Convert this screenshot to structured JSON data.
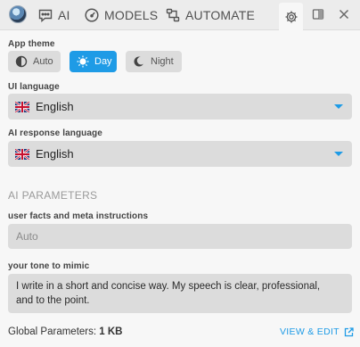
{
  "nav": {
    "ai_label": "AI",
    "models_label": "MODELS",
    "automate_label": "AUTOMATE"
  },
  "app_theme": {
    "label": "App theme",
    "options": [
      {
        "label": "Auto",
        "selected": false
      },
      {
        "label": "Day",
        "selected": true
      },
      {
        "label": "Night",
        "selected": false
      }
    ]
  },
  "ui_language": {
    "label": "UI language",
    "value": "English"
  },
  "ai_response_language": {
    "label": "AI response language",
    "value": "English"
  },
  "ai_parameters": {
    "title": "AI PARAMETERS",
    "facts_label": "user facts and meta instructions",
    "facts_placeholder": "Auto",
    "tone_label": "your tone to mimic",
    "tone_value": "I write in a short and concise way. My speech is clear, professional, and to the point."
  },
  "footer": {
    "global_params_label": "Global Parameters:",
    "global_params_size": "1 KB",
    "view_edit_label": "VIEW & EDIT"
  },
  "colors": {
    "accent": "#1e9be6",
    "field_bg": "#dcdcdc",
    "page_bg": "#f7f7f7"
  }
}
